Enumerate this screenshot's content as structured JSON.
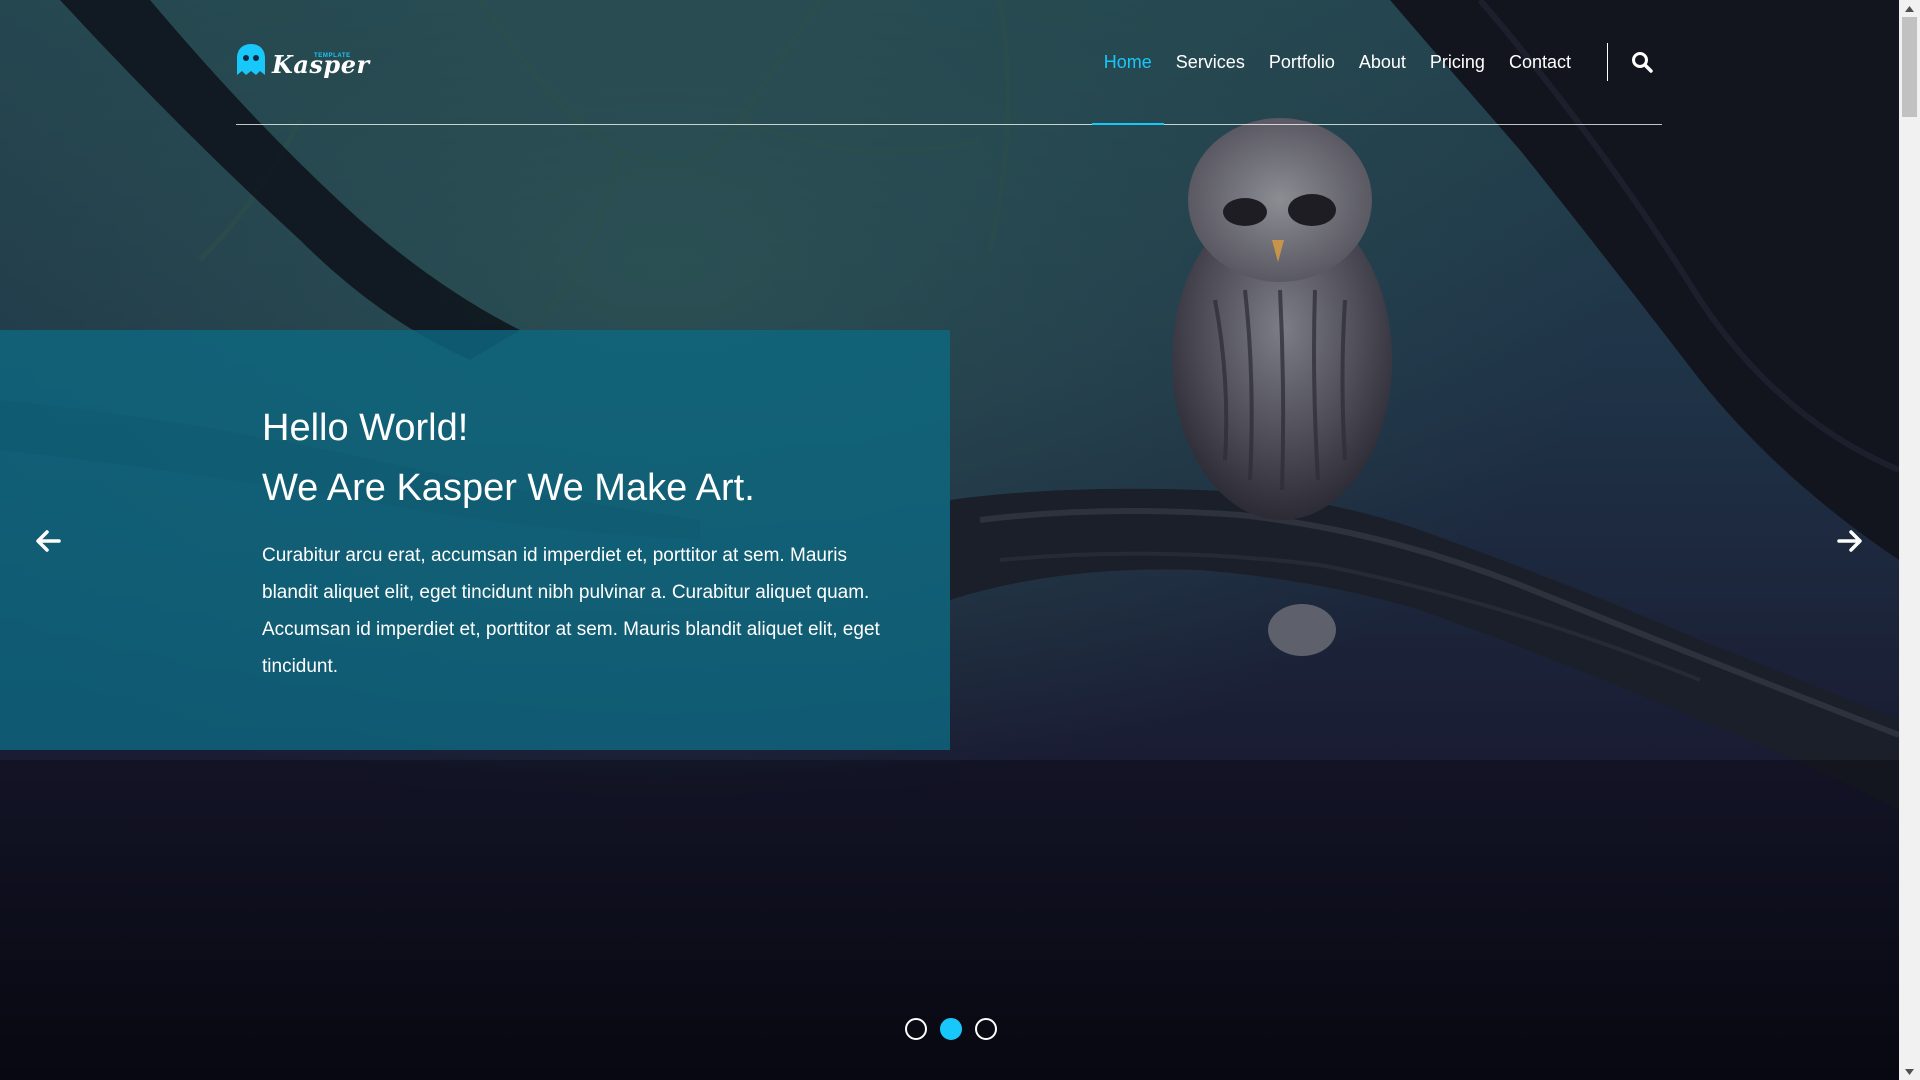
{
  "brand": {
    "name": "Kasper",
    "tagline": "TEMPLATE",
    "accent_color": "#19c8fa",
    "logo_icon": "ghost-icon"
  },
  "nav": {
    "items": [
      {
        "label": "Home",
        "active": true
      },
      {
        "label": "Services",
        "active": false
      },
      {
        "label": "Portfolio",
        "active": false
      },
      {
        "label": "About",
        "active": false
      },
      {
        "label": "Pricing",
        "active": false
      },
      {
        "label": "Contact",
        "active": false
      }
    ],
    "search_icon": "search-icon"
  },
  "hero": {
    "title_line1": "Hello World!",
    "title_line2": "We Are Kasper We Make Art.",
    "text": "Curabitur arcu erat, accumsan id imperdiet et, porttitor at sem. Mauris blandit aliquet elit, eget tincidunt nibh pulvinar a. Curabitur aliquet quam. Accumsan id imperdiet et, porttitor at sem. Mauris blandit aliquet elit, eget tincidunt.",
    "box_color": "#0e6880",
    "background_image": "owl perched on a branch in a dark forest"
  },
  "slider": {
    "prev_icon": "arrow-left-icon",
    "next_icon": "arrow-right-icon",
    "bullets": [
      {
        "active": false
      },
      {
        "active": true
      },
      {
        "active": false
      }
    ]
  }
}
